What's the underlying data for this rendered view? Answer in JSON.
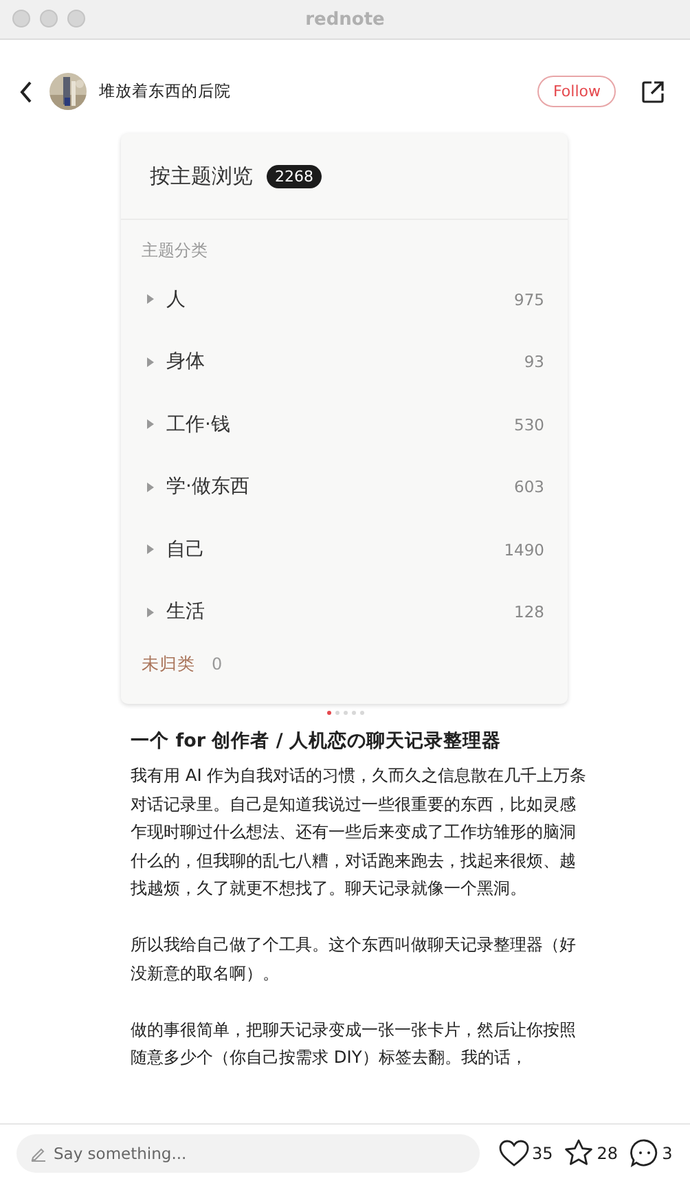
{
  "window": {
    "title": "rednote"
  },
  "header": {
    "author": "堆放着东西的后院",
    "follow": "Follow"
  },
  "card": {
    "title": "按主题浏览",
    "count": "2268",
    "section": "主题分类",
    "topics": [
      {
        "name": "人",
        "count": "975"
      },
      {
        "name": "身体",
        "count": "93"
      },
      {
        "name": "工作·钱",
        "count": "530"
      },
      {
        "name": "学·做东西",
        "count": "603"
      },
      {
        "name": "自己",
        "count": "1490"
      },
      {
        "name": "生活",
        "count": "128"
      }
    ],
    "uncategorized": {
      "name": "未归类",
      "count": "0"
    }
  },
  "carousel_dots": [
    {
      "selected": true
    },
    {
      "selected": false
    },
    {
      "selected": false
    },
    {
      "selected": false
    },
    {
      "selected": false
    }
  ],
  "post": {
    "title": "一个 for 创作者 / 人机恋の聊天记录整理器",
    "paragraphs": [
      "我有用 AI 作为自我对话的习惯，久而久之信息散在几千上万条对话记录里。自己是知道我说过一些很重要的东西，比如灵感乍现时聊过什么想法、还有一些后来变成了工作坊雏形的脑洞什么的，但我聊的乱七八糟，对话跑来跑去，找起来很烦、越找越烦，久了就更不想找了。聊天记录就像一个黑洞。",
      "所以我给自己做了个工具。这个东西叫做聊天记录整理器（好没新意的取名啊）。",
      "做的事很简单，把聊天记录变成一张一张卡片，然后让你按照随意多少个（你自己按需求 DIY）标签去翻。我的话，"
    ]
  },
  "bottom_bar": {
    "placeholder": "Say something...",
    "likes": "35",
    "stars": "28",
    "comments": "3"
  }
}
